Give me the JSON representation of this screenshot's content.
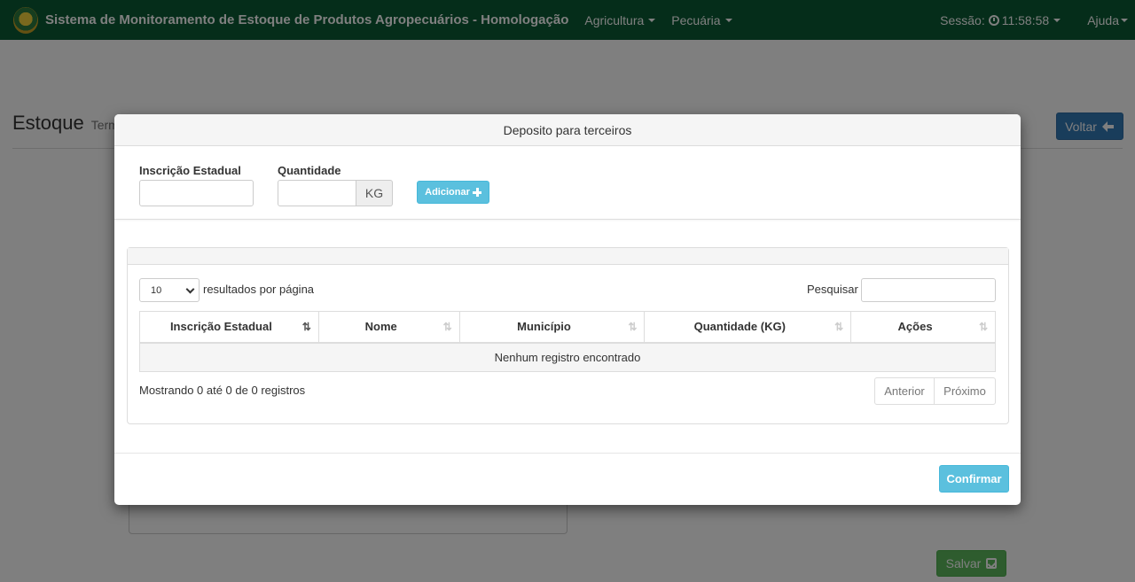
{
  "navbar": {
    "title": "Sistema de Monitoramento de Estoque de Produtos Agropecuários - Homologação",
    "menu_agricultura": "Agricultura",
    "menu_pecuaria": "Pecuária",
    "session_label": "Sessão:",
    "session_time": "11:58:58",
    "help_label": "Ajuda"
  },
  "page": {
    "title": "Estoque",
    "subtitle": "Term",
    "back_label": "Voltar",
    "save_label": "Salvar"
  },
  "modal": {
    "title": "Deposito para terceiros",
    "form": {
      "state_reg_label": "Inscrição Estadual",
      "state_reg_value": "",
      "quantity_label": "Quantidade",
      "quantity_value": "",
      "unit": "KG",
      "add_label": "Adicionar"
    },
    "table": {
      "length_value": "10",
      "length_label": "resultados por página",
      "search_label": "Pesquisar",
      "search_value": "",
      "columns": [
        "Inscrição Estadual",
        "Nome",
        "Município",
        "Quantidade (KG)",
        "Ações"
      ],
      "empty_message": "Nenhum registro encontrado",
      "info": "Mostrando 0 até 0 de 0 registros",
      "prev_label": "Anterior",
      "next_label": "Próximo"
    },
    "confirm_label": "Confirmar"
  },
  "colors": {
    "navbar": "#0b5a34",
    "primary": "#337ab7",
    "info": "#5bc0de",
    "success": "#5cb85c"
  },
  "icons": [
    "brand-logo",
    "caret-down-icon",
    "clock-icon",
    "arrow-left-icon",
    "check-icon",
    "plus-icon",
    "sort-icon",
    "chevron-down-icon"
  ]
}
